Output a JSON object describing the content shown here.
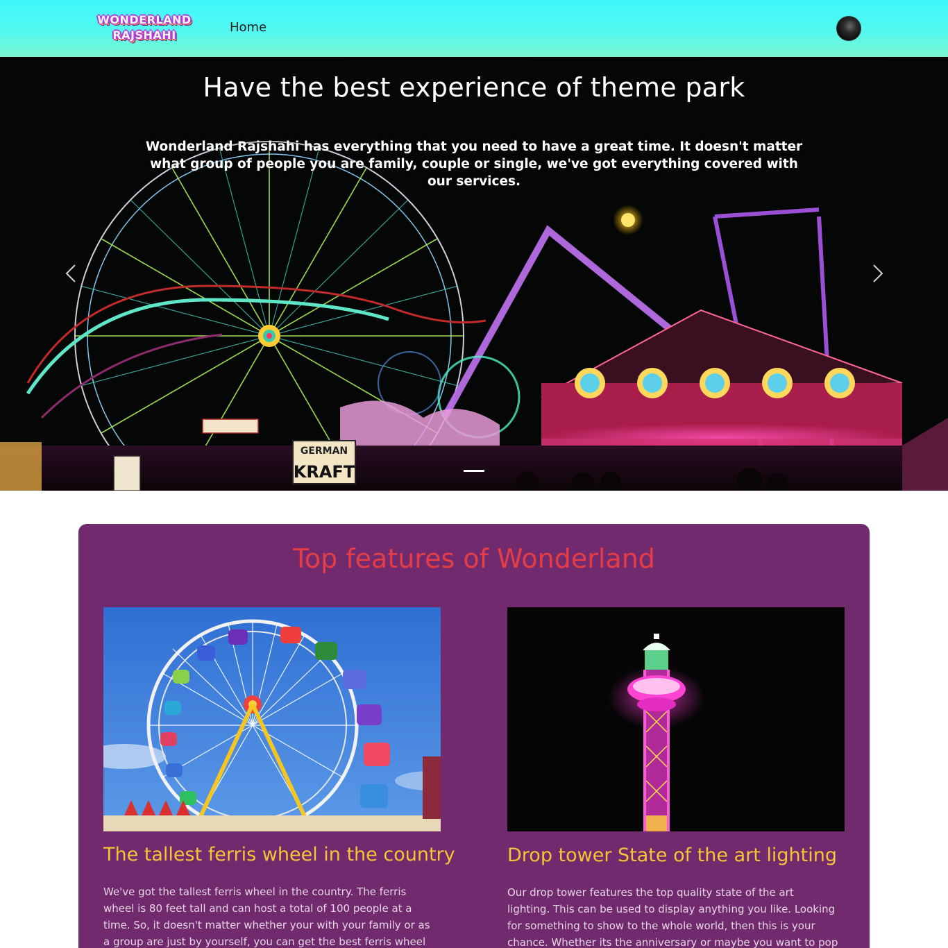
{
  "navbar": {
    "logo_line1": "WONDERLAND",
    "logo_line2": "RAJSHAHI",
    "home_link": "Home"
  },
  "hero": {
    "title": "Have the best experience of theme park",
    "text": "Wonderland Rajshahi has everything that you need to have a great time. It doesn't matter what group of people you are family, couple or single, we've got everything covered with our services.",
    "sign_german": "GERMAN",
    "sign_kraft": "KRAFT"
  },
  "features": {
    "title": "Top features of Wonderland",
    "cards": [
      {
        "title": "The tallest ferris wheel in the country",
        "text": "We've got the tallest ferris wheel in the country. The ferris wheel is 80 feet tall and can host a total of 100 people at a time. So, it doesn't matter whether your with your family or as a group are just by yourself, you can get the best ferris wheel experience you ever"
      },
      {
        "title": "Drop tower State of the art lighting",
        "text": "Our drop tower features the top quality state of the art lighting. This can be used to display anything you like. Looking for something to show to the whole world, then this is your chance. Whether its the anniversary or maybe you want to pop the biggest question to your"
      }
    ]
  },
  "colors": {
    "navbar_top": "#3ff7fb",
    "navbar_bottom": "#7cf6cd",
    "features_bg": "#722a6e",
    "features_title": "#e43d46",
    "card_title": "#f4c534"
  }
}
